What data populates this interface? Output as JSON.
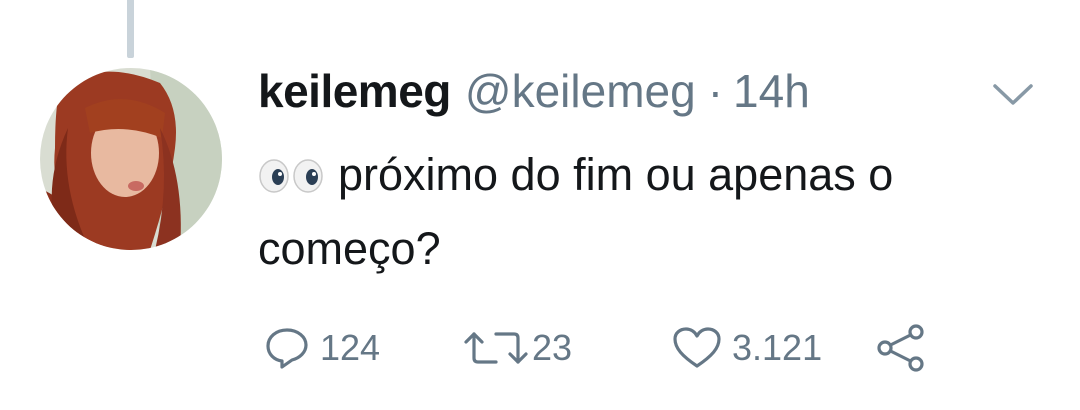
{
  "tweet": {
    "display_name": "keilemeg",
    "handle": "@keilemeg",
    "separator": "·",
    "time": "14h",
    "text": "próximo do fim ou apenas o começo?",
    "emoji": "eyes"
  },
  "actions": {
    "reply_count": "124",
    "retweet_count": "23",
    "like_count": "3.121"
  },
  "icons": [
    "reply-icon",
    "retweet-icon",
    "like-icon",
    "share-icon",
    "chevron-down-icon"
  ],
  "colors": {
    "text": "#14171a",
    "secondary": "#657786",
    "thread_line": "#c9d3da"
  }
}
